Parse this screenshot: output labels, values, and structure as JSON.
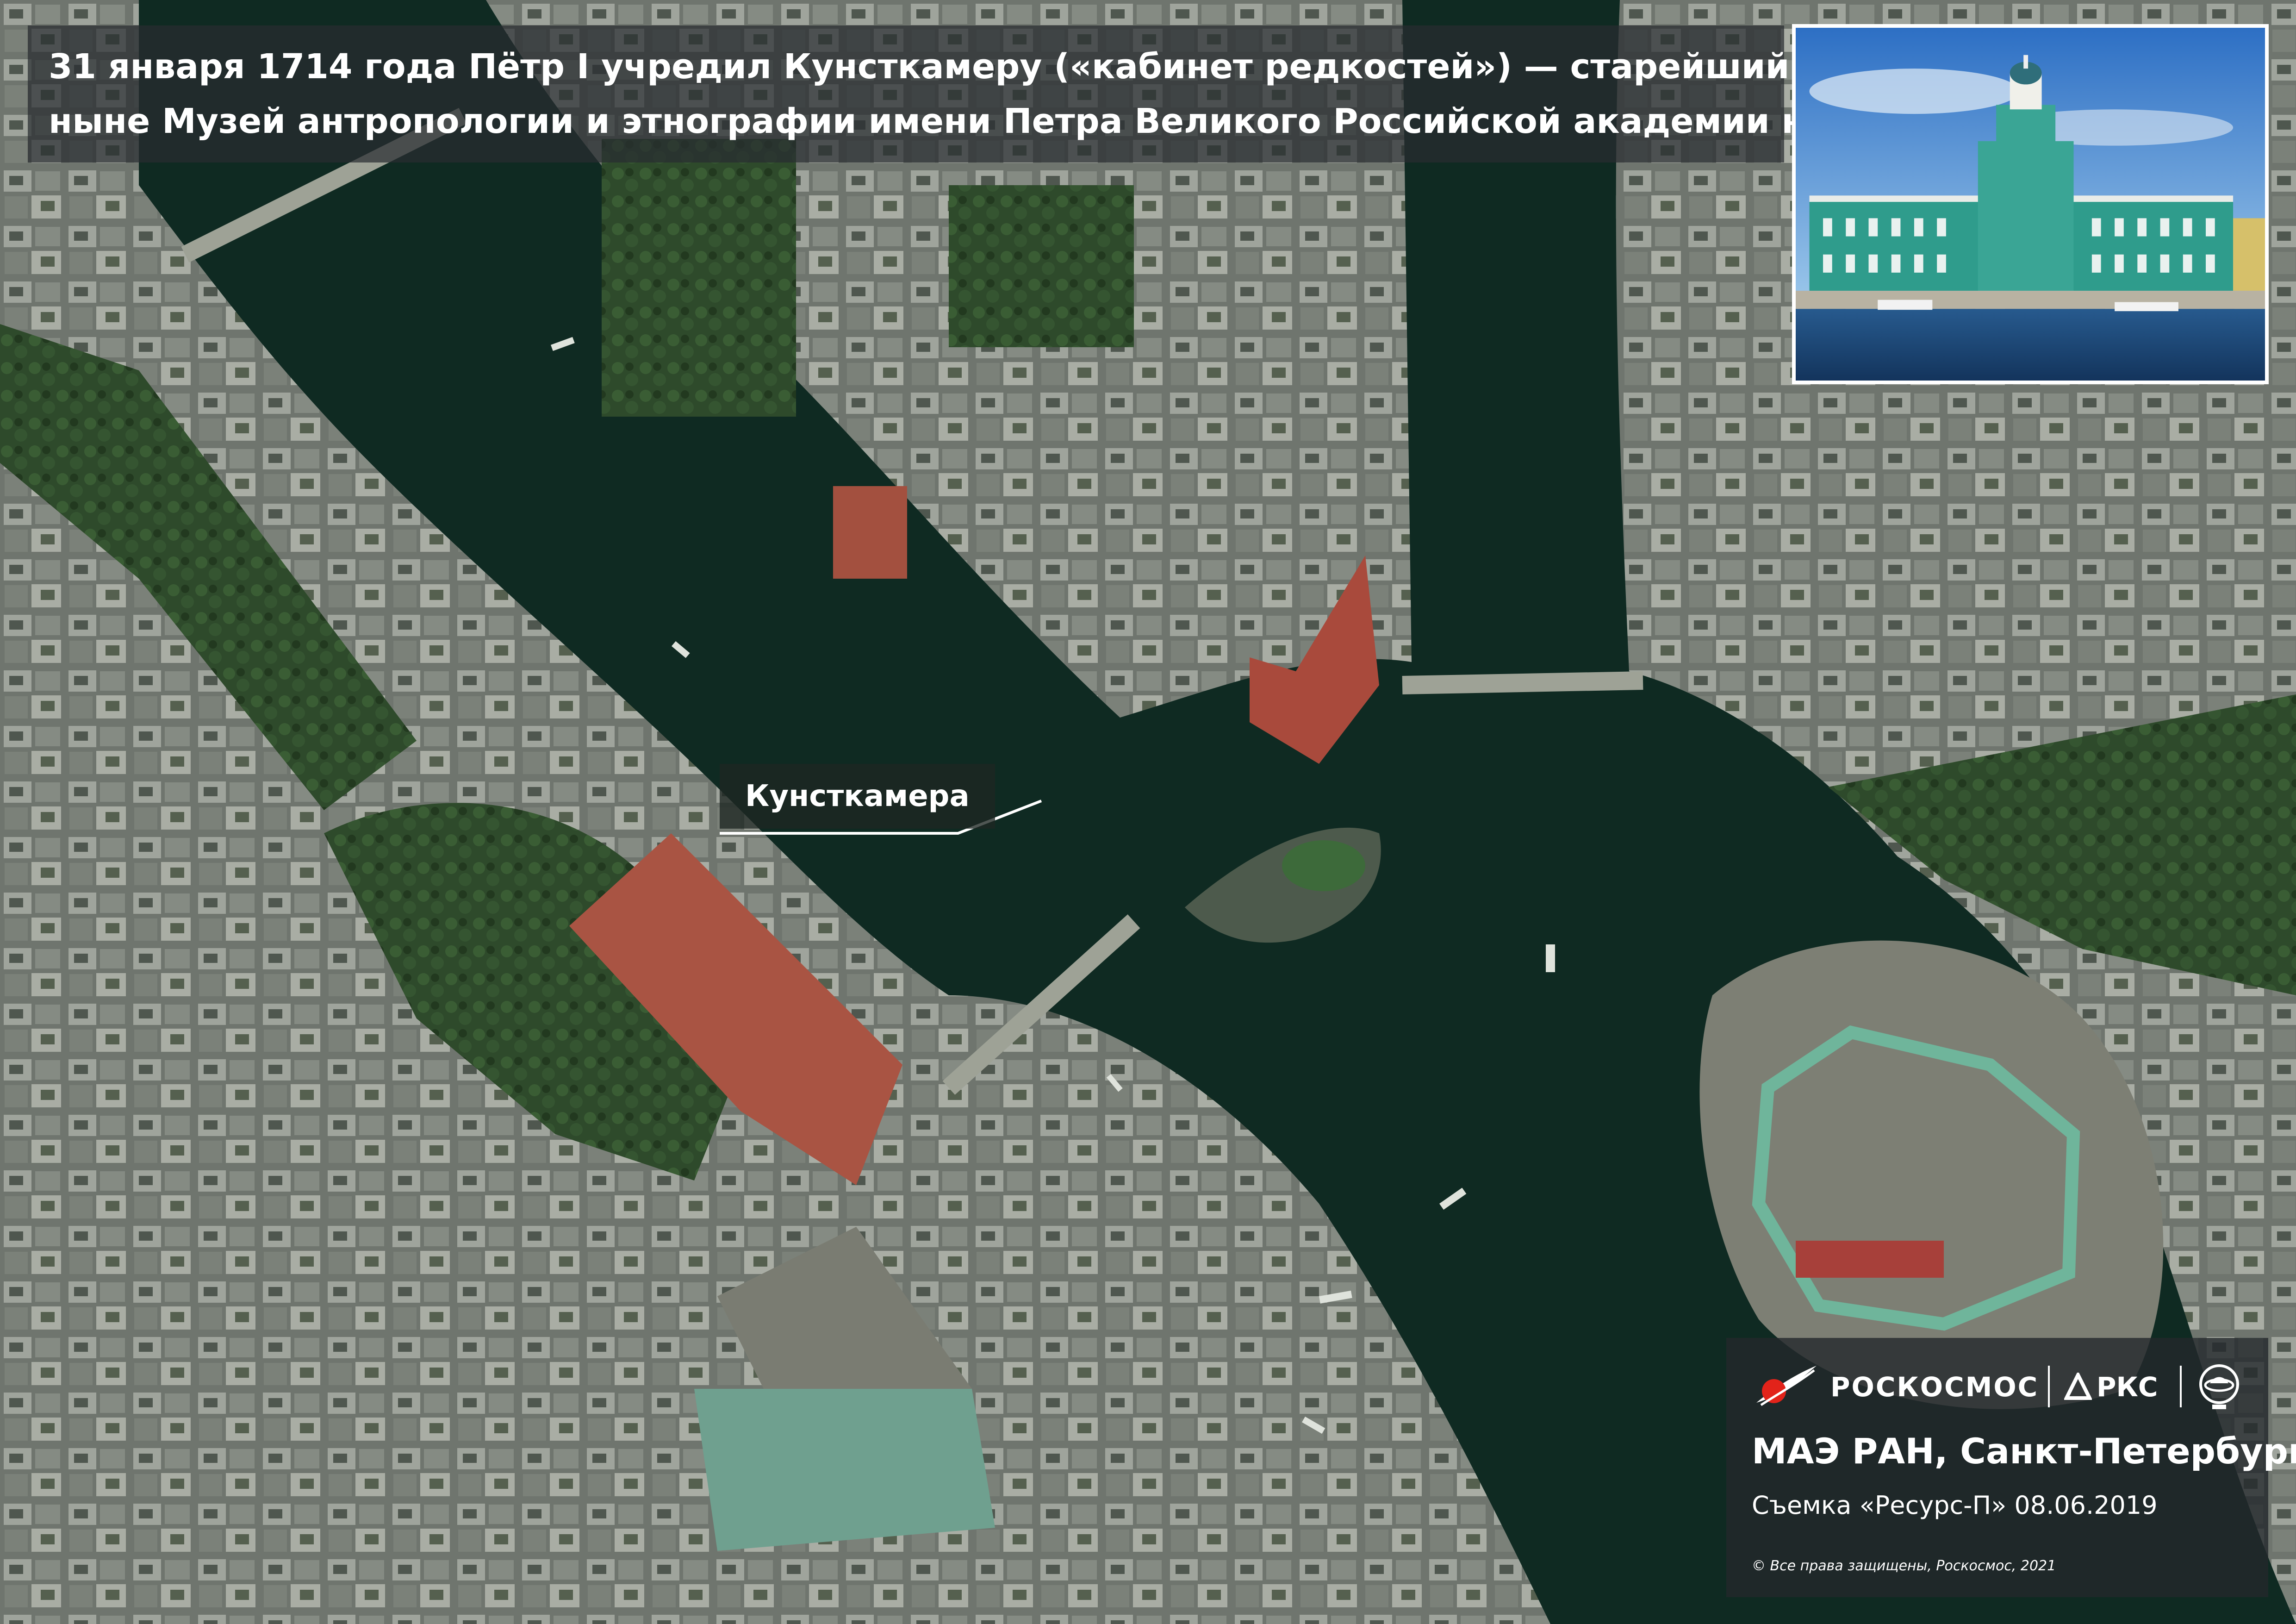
{
  "headline": {
    "line1": "31 января 1714 года Пётр I учредил Кунсткамеру («кабинет редкостей») — старейший музей в России,",
    "line2": "ныне Музей антропологии и этнографии имени Петра Великого Российской академии наук"
  },
  "callout": {
    "label": "Кунсткамера"
  },
  "inset_photo": {
    "subject": "Kunstkamera building photo"
  },
  "credits": {
    "roscosmos": "РОСКОСМОС",
    "rks": "РКС",
    "place": "МАЭ РАН, Санкт-Петербург",
    "capture": "Съемка «Ресурс-П» 08.06.2019",
    "rights": "© Все права защищены, Роскосмос, 2021"
  },
  "colors": {
    "river": "#0f2a22",
    "city": "#8a8f86",
    "parks": "#2c4a2a",
    "roofs_red": "#a84a3a"
  }
}
